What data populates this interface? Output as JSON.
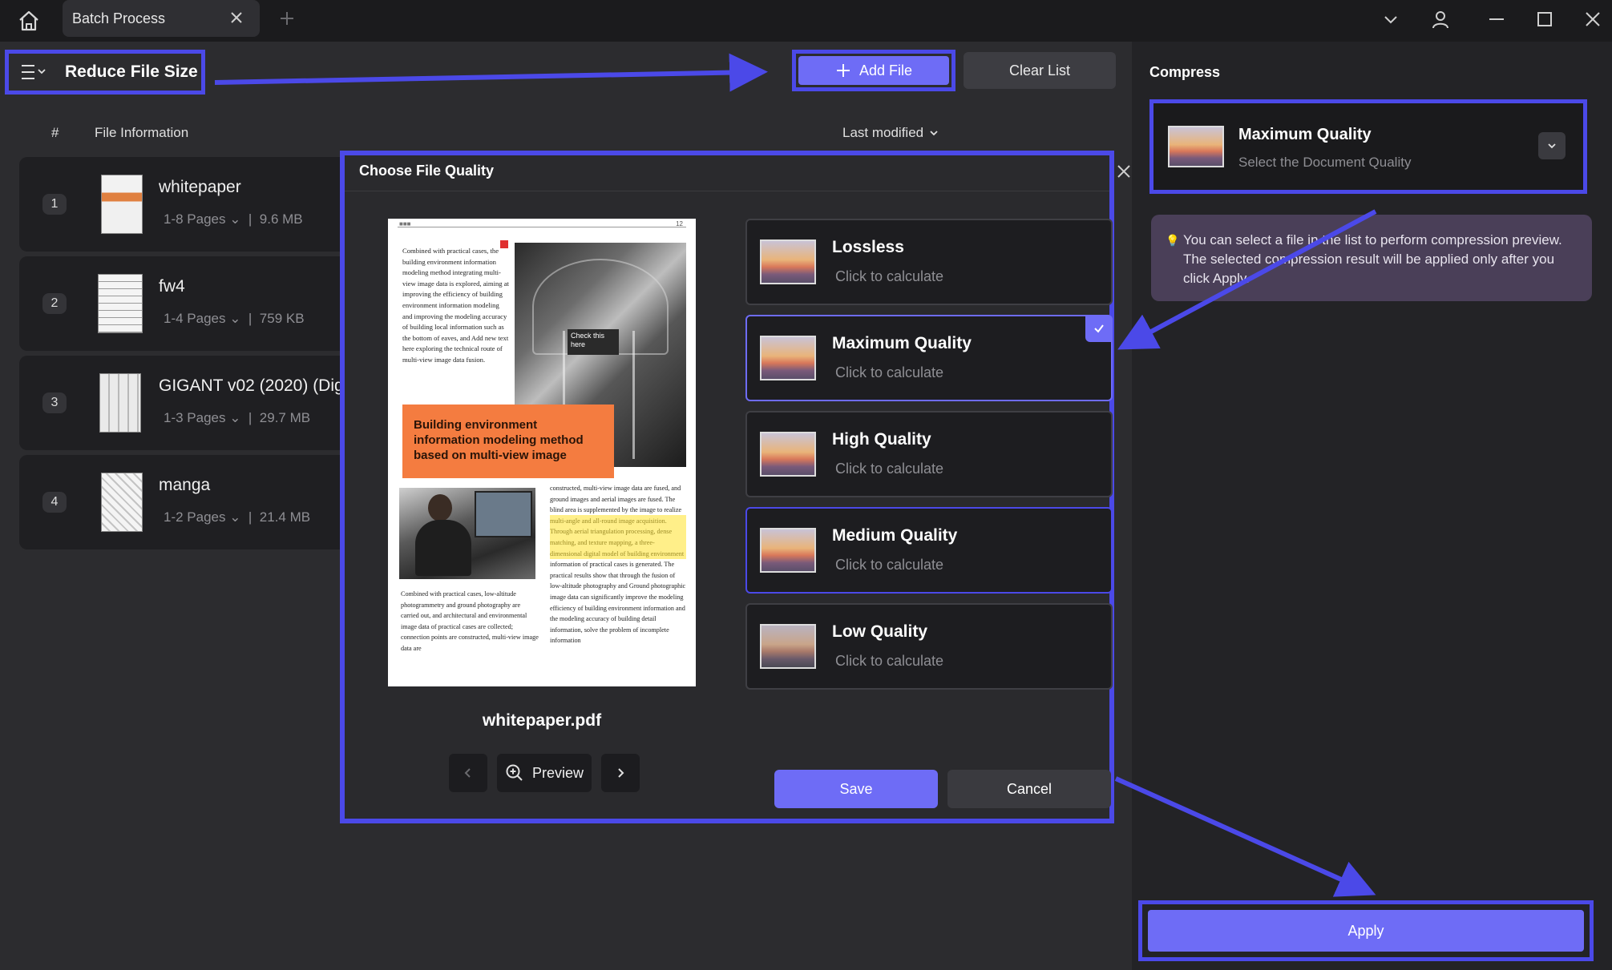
{
  "window": {
    "tab_title": "Batch Process"
  },
  "toolbar": {
    "mode_title": "Reduce File Size",
    "add_file_label": "Add File",
    "clear_list_label": "Clear List"
  },
  "file_list": {
    "col_number": "#",
    "col_info": "File Information",
    "sort_label": "Last modified",
    "files": [
      {
        "index": "1",
        "name": "whitepaper",
        "pages": "1-8 Pages",
        "size": "9.6 MB"
      },
      {
        "index": "2",
        "name": "fw4",
        "pages": "1-4 Pages",
        "size": "759 KB"
      },
      {
        "index": "3",
        "name": "GIGANT v02 (2020) (Dig",
        "pages": "1-3 Pages",
        "size": "29.7 MB"
      },
      {
        "index": "4",
        "name": "manga",
        "pages": "1-2 Pages",
        "size": "21.4 MB"
      }
    ]
  },
  "compress_panel": {
    "title": "Compress",
    "selected_quality": "Maximum Quality",
    "selected_subtitle": "Select the Document Quality",
    "tip": "You can select a file in the list to perform compression preview. The selected compression result will be applied only after you click Apply.",
    "apply_label": "Apply"
  },
  "dialog": {
    "title": "Choose File Quality",
    "preview_filename": "whitepaper.pdf",
    "preview_button_label": "Preview",
    "save_label": "Save",
    "cancel_label": "Cancel",
    "options": [
      {
        "name": "Lossless",
        "hint": "Click to calculate",
        "selected": false
      },
      {
        "name": "Maximum Quality",
        "hint": "Click to calculate",
        "selected": true
      },
      {
        "name": "High Quality",
        "hint": "Click to calculate",
        "selected": false
      },
      {
        "name": "Medium Quality",
        "hint": "Click to calculate",
        "selected": false
      },
      {
        "name": "Low Quality",
        "hint": "Click to calculate",
        "selected": false
      }
    ],
    "page_preview": {
      "page_number": "12",
      "callout_text": "Check this here",
      "banner_text": "Building environment information modeling method based on multi-view image",
      "col1_text": "Combined with practical cases, the building environment information modeling method integrating multi-view image data is explored, aiming at improving the efficiency of building environment information modeling and improving the modeling accuracy of building local information such as the bottom of eaves, and Add new text here exploring the technical route of multi-view image data fusion.",
      "col2_text": "constructed, multi-view image data are fused, and ground images and aerial images are fused. The blind area is supplemented by the image to realize multi-angle and all-round image acquisition. Through aerial triangulation processing, dense matching, and texture mapping, a three-dimensional digital model of building environment information of practical cases is generated. The practical results show that through the fusion of low-altitude photography and Ground photographic image data can significantly improve the modeling efficiency of building environment information and the modeling accuracy of building detail information, solve the problem of incomplete information",
      "col3_text": "Combined with practical cases, low-altitude photogrammetry and ground photography are carried out, and architectural and environmental image data of practical cases are collected; connection points are constructed, multi-view image data are"
    }
  },
  "colors": {
    "accent": "#6e6cf6",
    "highlight_border": "#4b49e8",
    "background": "#2c2c2f",
    "banner_orange": "#f47c40"
  }
}
